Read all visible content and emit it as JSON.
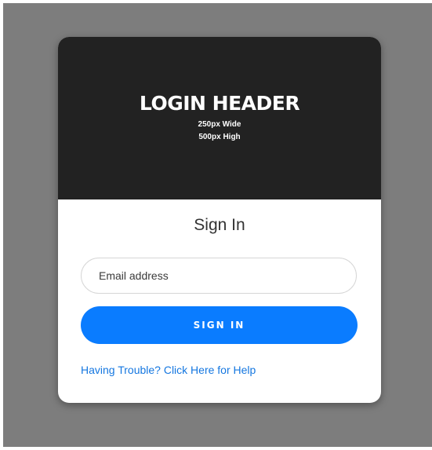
{
  "header": {
    "title": "LOGIN HEADER",
    "subtitle_line1": "250px Wide",
    "subtitle_line2": "500px High"
  },
  "form": {
    "heading": "Sign In",
    "email_placeholder": "Email address",
    "email_value": "",
    "submit_label": "SIGN IN",
    "help_link": "Having Trouble? Click Here for Help"
  },
  "colors": {
    "backdrop": "#7d7d7d",
    "header_bg": "#222222",
    "button_bg": "#0a7cff",
    "link": "#1577e0"
  }
}
